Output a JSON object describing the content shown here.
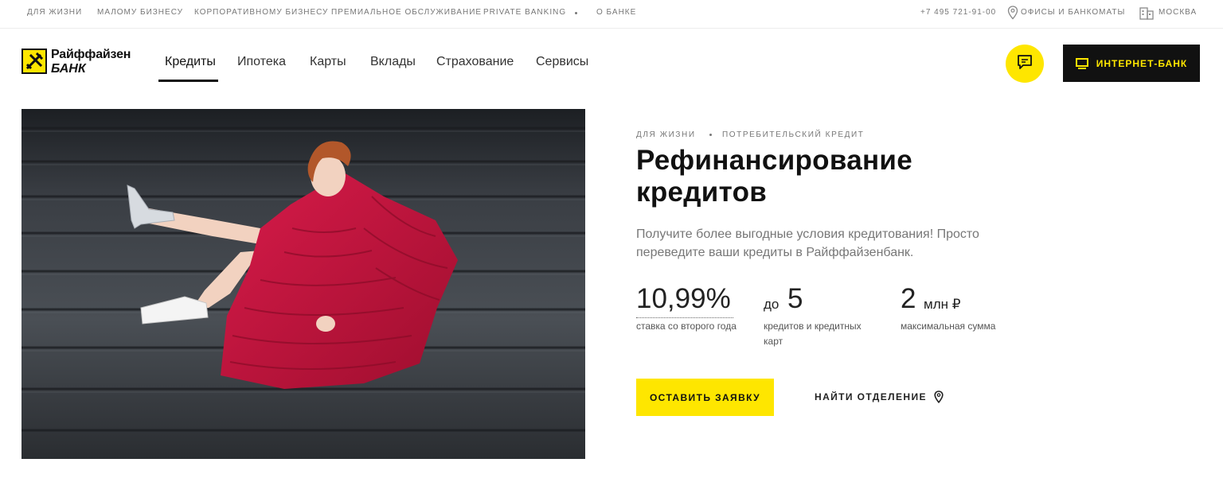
{
  "topbar": {
    "links": [
      "Для жизни",
      "Малому бизнесу",
      "Корпоративному бизнесу",
      "Премиальное обслуживание",
      "Private Banking",
      "О банке"
    ],
    "phone": "+7 495 721-91-00",
    "offices_label": "Офисы и банкоматы",
    "city_label": "Москва"
  },
  "logo": {
    "line1": "Райффайзен",
    "line2": "БАНК",
    "brand_color": "#fee600"
  },
  "nav": {
    "items": [
      "Кредиты",
      "Ипотека",
      "Карты",
      "Вклады",
      "Страхование",
      "Сервисы"
    ],
    "active": "Кредиты"
  },
  "header": {
    "internet_bank_label": "Интернет-банк",
    "chat_icon": "chat-bubble-icon"
  },
  "breadcrumb": {
    "items": [
      "Для жизни",
      "Потребительский кредит"
    ]
  },
  "page": {
    "title_line1": "Рефинансирование",
    "title_line2": "кредитов",
    "description": "Получите более выгодные условия кредитования! Просто переведите ваши кредиты в Райффайзенбанк."
  },
  "stats": [
    {
      "value": "10,99%",
      "label": "ставка со второго года"
    },
    {
      "prefix": "до",
      "value": "5",
      "label": "кредитов и кредитных карт"
    },
    {
      "value": "2",
      "unit": "млн ₽",
      "label": "максимальная сумма"
    }
  ],
  "actions": {
    "apply_label": "Оставить заявку",
    "find_branch_label": "Найти отделение"
  },
  "colors": {
    "accent": "#fee600",
    "dark": "#111111",
    "coat": "#c8143c",
    "dress": "#d9a21a"
  }
}
